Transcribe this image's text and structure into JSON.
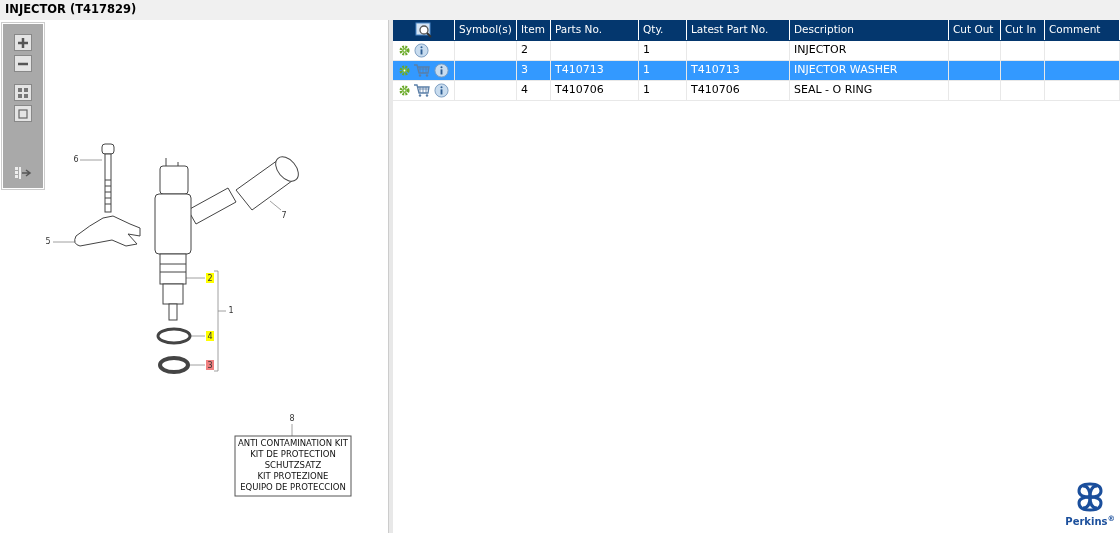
{
  "title": "INJECTOR (T417829)",
  "callouts": [
    {
      "label": "6",
      "highlighted": false,
      "selected": false
    },
    {
      "label": "5",
      "highlighted": false,
      "selected": false
    },
    {
      "label": "7",
      "highlighted": false,
      "selected": false
    },
    {
      "label": "2",
      "highlighted": true,
      "selected": false
    },
    {
      "label": "1",
      "highlighted": false,
      "selected": false
    },
    {
      "label": "4",
      "highlighted": true,
      "selected": false
    },
    {
      "label": "3",
      "highlighted": true,
      "selected": true
    },
    {
      "label": "8",
      "highlighted": false,
      "selected": false
    }
  ],
  "kit_note": [
    "ANTI CONTAMINATION KIT",
    "KIT DE PROTECTION",
    "SCHUTZSATZ",
    "KIT PROTEZIONE",
    "EQUIPO DE PROTECCION"
  ],
  "table": {
    "columns": [
      "Symbol(s)",
      "Item",
      "Parts No.",
      "Qty.",
      "Latest Part No.",
      "Description",
      "Cut Out",
      "Cut In",
      "Comment"
    ],
    "rows": [
      {
        "orderable": false,
        "selected": false,
        "cells": [
          "",
          "2",
          "",
          "1",
          "",
          "INJECTOR",
          "",
          "",
          ""
        ]
      },
      {
        "orderable": true,
        "selected": true,
        "cells": [
          "",
          "3",
          "T410713",
          "1",
          "T410713",
          "INJECTOR WASHER",
          "",
          "",
          ""
        ]
      },
      {
        "orderable": true,
        "selected": false,
        "cells": [
          "",
          "4",
          "T410706",
          "1",
          "T410706",
          "SEAL - O RING",
          "",
          "",
          ""
        ]
      }
    ]
  },
  "brand": "Perkins$^{®}$"
}
